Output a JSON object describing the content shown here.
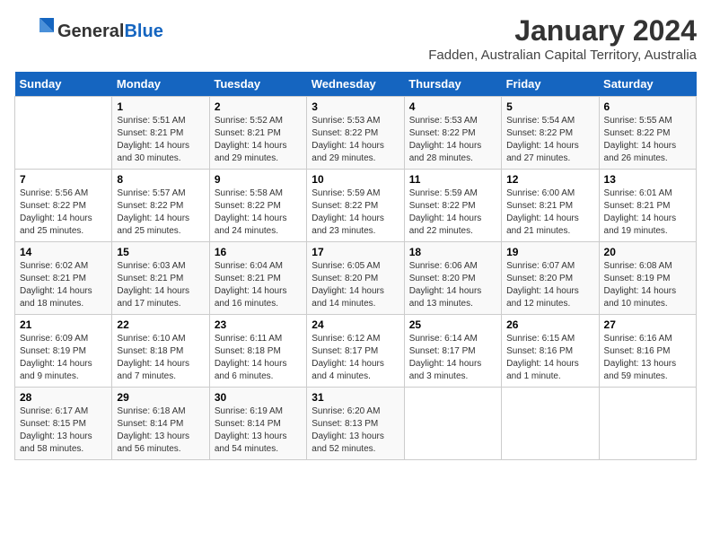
{
  "header": {
    "logo_general": "General",
    "logo_blue": "Blue",
    "main_title": "January 2024",
    "subtitle": "Fadden, Australian Capital Territory, Australia"
  },
  "calendar": {
    "days_of_week": [
      "Sunday",
      "Monday",
      "Tuesday",
      "Wednesday",
      "Thursday",
      "Friday",
      "Saturday"
    ],
    "weeks": [
      [
        {
          "num": "",
          "info": ""
        },
        {
          "num": "1",
          "info": "Sunrise: 5:51 AM\nSunset: 8:21 PM\nDaylight: 14 hours\nand 30 minutes."
        },
        {
          "num": "2",
          "info": "Sunrise: 5:52 AM\nSunset: 8:21 PM\nDaylight: 14 hours\nand 29 minutes."
        },
        {
          "num": "3",
          "info": "Sunrise: 5:53 AM\nSunset: 8:22 PM\nDaylight: 14 hours\nand 29 minutes."
        },
        {
          "num": "4",
          "info": "Sunrise: 5:53 AM\nSunset: 8:22 PM\nDaylight: 14 hours\nand 28 minutes."
        },
        {
          "num": "5",
          "info": "Sunrise: 5:54 AM\nSunset: 8:22 PM\nDaylight: 14 hours\nand 27 minutes."
        },
        {
          "num": "6",
          "info": "Sunrise: 5:55 AM\nSunset: 8:22 PM\nDaylight: 14 hours\nand 26 minutes."
        }
      ],
      [
        {
          "num": "7",
          "info": "Sunrise: 5:56 AM\nSunset: 8:22 PM\nDaylight: 14 hours\nand 25 minutes."
        },
        {
          "num": "8",
          "info": "Sunrise: 5:57 AM\nSunset: 8:22 PM\nDaylight: 14 hours\nand 25 minutes."
        },
        {
          "num": "9",
          "info": "Sunrise: 5:58 AM\nSunset: 8:22 PM\nDaylight: 14 hours\nand 24 minutes."
        },
        {
          "num": "10",
          "info": "Sunrise: 5:59 AM\nSunset: 8:22 PM\nDaylight: 14 hours\nand 23 minutes."
        },
        {
          "num": "11",
          "info": "Sunrise: 5:59 AM\nSunset: 8:22 PM\nDaylight: 14 hours\nand 22 minutes."
        },
        {
          "num": "12",
          "info": "Sunrise: 6:00 AM\nSunset: 8:21 PM\nDaylight: 14 hours\nand 21 minutes."
        },
        {
          "num": "13",
          "info": "Sunrise: 6:01 AM\nSunset: 8:21 PM\nDaylight: 14 hours\nand 19 minutes."
        }
      ],
      [
        {
          "num": "14",
          "info": "Sunrise: 6:02 AM\nSunset: 8:21 PM\nDaylight: 14 hours\nand 18 minutes."
        },
        {
          "num": "15",
          "info": "Sunrise: 6:03 AM\nSunset: 8:21 PM\nDaylight: 14 hours\nand 17 minutes."
        },
        {
          "num": "16",
          "info": "Sunrise: 6:04 AM\nSunset: 8:21 PM\nDaylight: 14 hours\nand 16 minutes."
        },
        {
          "num": "17",
          "info": "Sunrise: 6:05 AM\nSunset: 8:20 PM\nDaylight: 14 hours\nand 14 minutes."
        },
        {
          "num": "18",
          "info": "Sunrise: 6:06 AM\nSunset: 8:20 PM\nDaylight: 14 hours\nand 13 minutes."
        },
        {
          "num": "19",
          "info": "Sunrise: 6:07 AM\nSunset: 8:20 PM\nDaylight: 14 hours\nand 12 minutes."
        },
        {
          "num": "20",
          "info": "Sunrise: 6:08 AM\nSunset: 8:19 PM\nDaylight: 14 hours\nand 10 minutes."
        }
      ],
      [
        {
          "num": "21",
          "info": "Sunrise: 6:09 AM\nSunset: 8:19 PM\nDaylight: 14 hours\nand 9 minutes."
        },
        {
          "num": "22",
          "info": "Sunrise: 6:10 AM\nSunset: 8:18 PM\nDaylight: 14 hours\nand 7 minutes."
        },
        {
          "num": "23",
          "info": "Sunrise: 6:11 AM\nSunset: 8:18 PM\nDaylight: 14 hours\nand 6 minutes."
        },
        {
          "num": "24",
          "info": "Sunrise: 6:12 AM\nSunset: 8:17 PM\nDaylight: 14 hours\nand 4 minutes."
        },
        {
          "num": "25",
          "info": "Sunrise: 6:14 AM\nSunset: 8:17 PM\nDaylight: 14 hours\nand 3 minutes."
        },
        {
          "num": "26",
          "info": "Sunrise: 6:15 AM\nSunset: 8:16 PM\nDaylight: 14 hours\nand 1 minute."
        },
        {
          "num": "27",
          "info": "Sunrise: 6:16 AM\nSunset: 8:16 PM\nDaylight: 13 hours\nand 59 minutes."
        }
      ],
      [
        {
          "num": "28",
          "info": "Sunrise: 6:17 AM\nSunset: 8:15 PM\nDaylight: 13 hours\nand 58 minutes."
        },
        {
          "num": "29",
          "info": "Sunrise: 6:18 AM\nSunset: 8:14 PM\nDaylight: 13 hours\nand 56 minutes."
        },
        {
          "num": "30",
          "info": "Sunrise: 6:19 AM\nSunset: 8:14 PM\nDaylight: 13 hours\nand 54 minutes."
        },
        {
          "num": "31",
          "info": "Sunrise: 6:20 AM\nSunset: 8:13 PM\nDaylight: 13 hours\nand 52 minutes."
        },
        {
          "num": "",
          "info": ""
        },
        {
          "num": "",
          "info": ""
        },
        {
          "num": "",
          "info": ""
        }
      ]
    ]
  }
}
